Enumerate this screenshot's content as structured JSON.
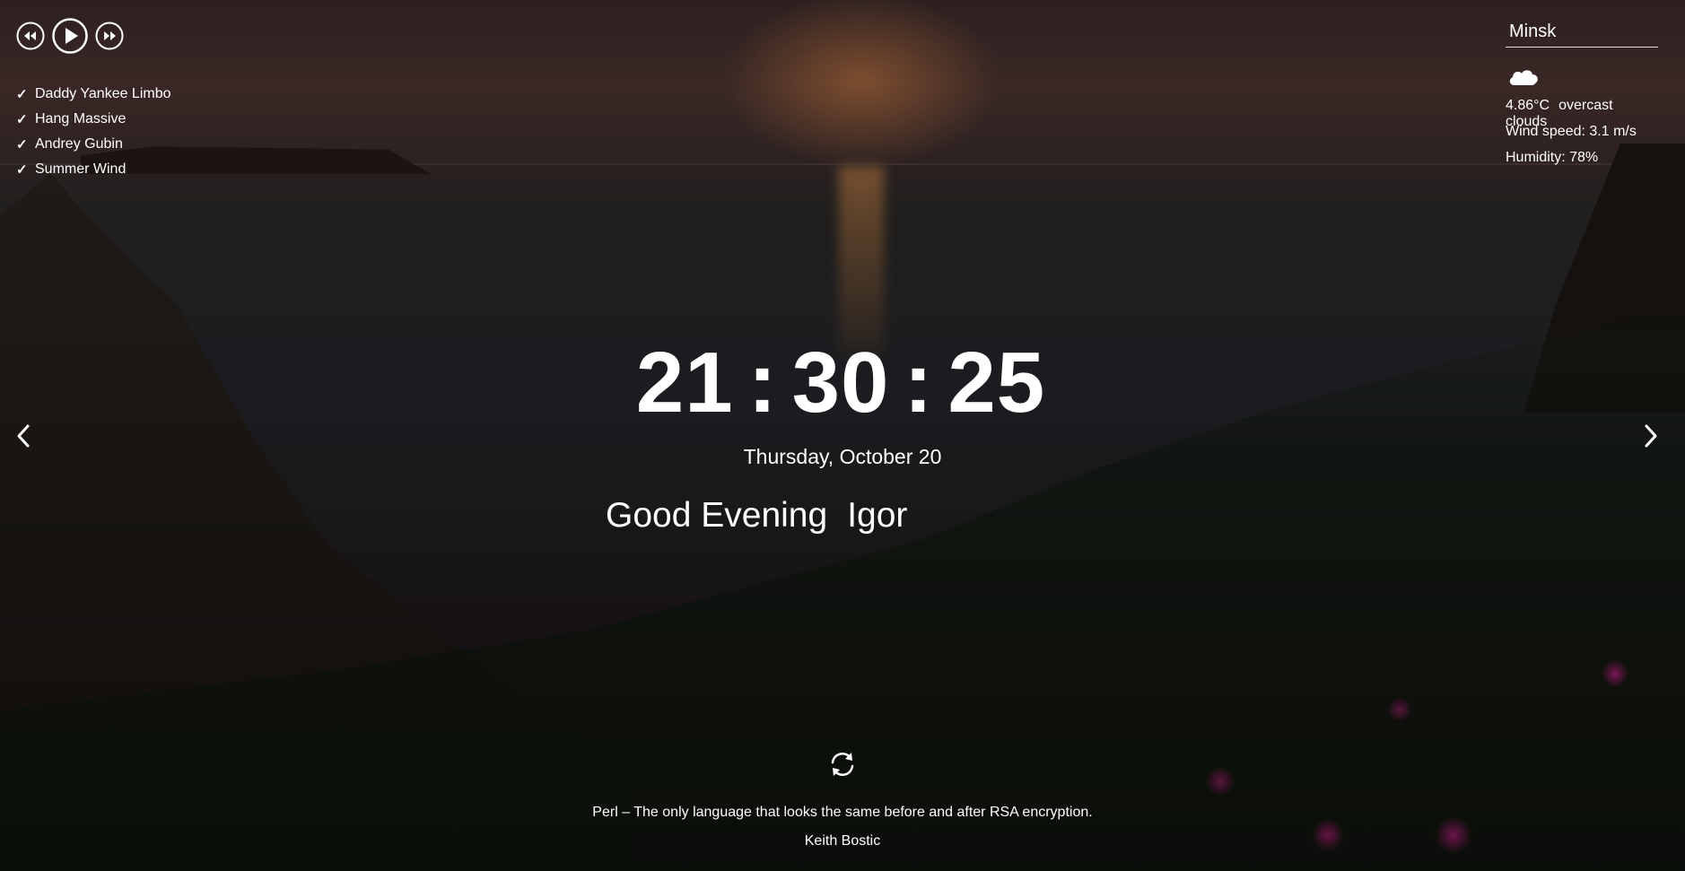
{
  "player": {
    "prev_icon": "rewind-icon",
    "play_icon": "play-icon",
    "next_icon": "fast-forward-icon",
    "playlist": [
      {
        "title": "Daddy Yankee Limbo",
        "icon": "check-icon"
      },
      {
        "title": "Hang Massive",
        "icon": "check-icon"
      },
      {
        "title": "Andrey Gubin",
        "icon": "check-icon"
      },
      {
        "title": "Summer Wind",
        "icon": "check-icon"
      }
    ]
  },
  "weather": {
    "city": "Minsk",
    "icon": "cloud-icon",
    "temperature": "4.86°C",
    "description": "overcast clouds",
    "wind": "Wind speed: 3.1 m/s",
    "humidity": "Humidity: 78%"
  },
  "slider": {
    "prev_icon": "chevron-left-icon",
    "next_icon": "chevron-right-icon"
  },
  "clock": {
    "hours": "21",
    "minutes": "30",
    "seconds": "25",
    "separator": ":"
  },
  "date": "Thursday, October 20",
  "greeting": {
    "text": "Good Evening",
    "name": "Igor"
  },
  "quote": {
    "refresh_icon": "refresh-icon",
    "text": "Perl – The only language that looks the same before and after RSA encryption.",
    "author": "Keith Bostic"
  },
  "colors": {
    "text": "#ffffff",
    "flower_accent": "#be1e82"
  }
}
